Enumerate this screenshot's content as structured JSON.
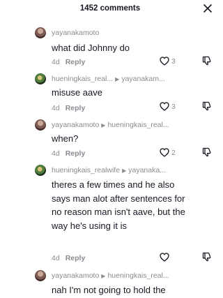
{
  "header": {
    "title": "1452 comments"
  },
  "comments": [
    {
      "author": "yayanakamoto",
      "reply_to": "",
      "text": "what did Johnny do",
      "age": "4d",
      "reply_label": "Reply",
      "likes": "3"
    },
    {
      "author": "hueningkais_real...",
      "reply_to": "yayanakam...",
      "text": "misuse aave",
      "age": "4d",
      "reply_label": "Reply",
      "likes": "3"
    },
    {
      "author": "yayanakamoto",
      "reply_to": "hueningkais_real...",
      "text": "when?",
      "age": "4d",
      "reply_label": "Reply",
      "likes": "2"
    },
    {
      "author": "hueningkais_realwife",
      "reply_to": "yayanaka...",
      "text": "theres a few times and he also says man alot after sentences for no reason man isn't aave, but the way he's using it is",
      "age": "4d",
      "reply_label": "Reply",
      "likes": ""
    },
    {
      "author": "yayanakamoto",
      "reply_to": "hueningkais_real...",
      "text": "nah I'm not going to hold the",
      "age": "",
      "reply_label": "",
      "likes": ""
    }
  ]
}
